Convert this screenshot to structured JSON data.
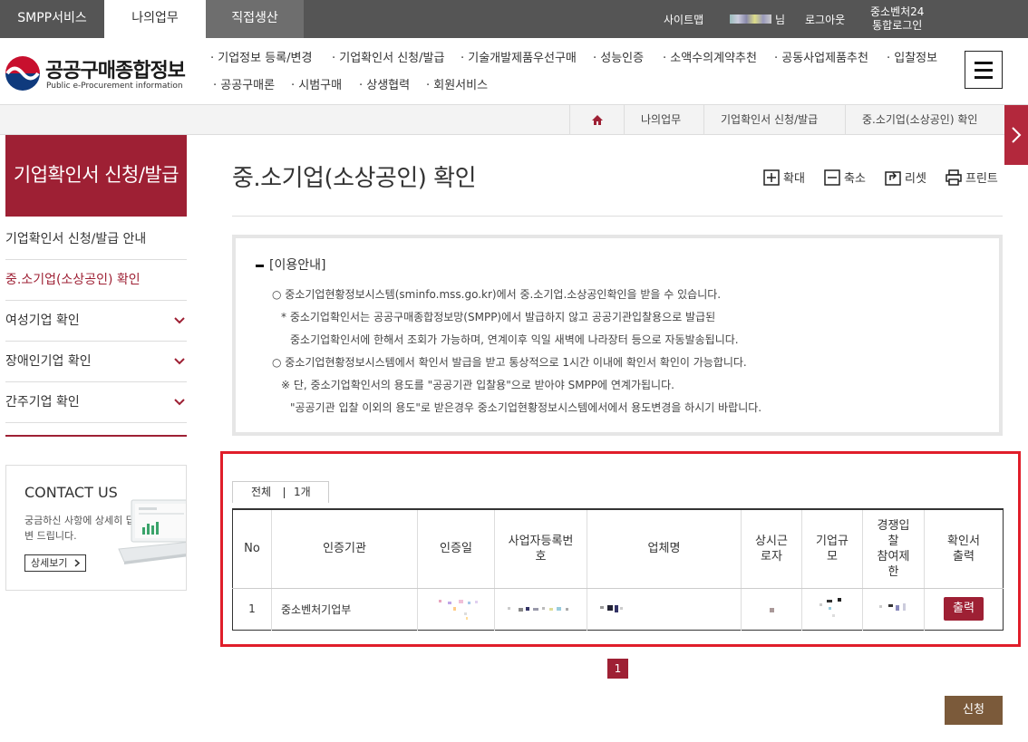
{
  "top_tabs": [
    "SMPP서비스",
    "나의업무",
    "직접생산"
  ],
  "top_util": {
    "sitemap": "사이트맵",
    "user_suffix": "님",
    "logout": "로그아웃",
    "ventures_line1": "중소벤처24",
    "ventures_line2": "통합로그인"
  },
  "logo": {
    "title": "공공구매종합정보",
    "subtitle": "Public e-Procurement information"
  },
  "gnb": [
    "기업정보 등록/변경",
    "기업확인서 신청/발급",
    "기술개발제품우선구매",
    "성능인증",
    "소액수의계약추천",
    "공동사업제품추천",
    "입찰정보",
    "공공구매론",
    "시범구매",
    "상생협력",
    "회원서비스"
  ],
  "breadcrumb": [
    "나의업무",
    "기업확인서 신청/발급",
    "중.소기업(소상공인) 확인"
  ],
  "sidebar": {
    "title": "기업확인서 신청/발급",
    "items": [
      {
        "label": "기업확인서 신청/발급 안내",
        "has_children": false,
        "active": false
      },
      {
        "label": "중.소기업(소상공인) 확인",
        "has_children": false,
        "active": true
      },
      {
        "label": "여성기업 확인",
        "has_children": true,
        "active": false
      },
      {
        "label": "장애인기업 확인",
        "has_children": true,
        "active": false
      },
      {
        "label": "간주기업 확인",
        "has_children": true,
        "active": false
      }
    ],
    "contact": {
      "heading": "CONTACT US",
      "desc": "궁금하신 사항에 상세히 답변 드립니다.",
      "button": "상세보기"
    }
  },
  "page": {
    "title": "중.소기업(소상공인) 확인",
    "tools": {
      "zoom_in": "확대",
      "zoom_out": "축소",
      "reset": "리셋",
      "print": "프린트"
    }
  },
  "notice": {
    "heading": "[이용안내]",
    "lines": [
      "○ 중소기업현황정보시스템(sminfo.mss.go.kr)에서 중.소기업.소상공인확인을 받을 수 있습니다.",
      "* 중소기업확인서는 공공구매종합정보망(SMPP)에서 발급하지 않고 공공기관입찰용으로 발급된",
      "중소기업확인서에 한해서 조회가 가능하며, 연계이후 익일 새벽에 나라장터 등으로 자동발송됩니다.",
      "○ 중소기업현황정보시스템에서 확인서 발급을 받고 통상적으로 1시간 이내에 확인서 확인이 가능합니다.",
      "※ 단, 중소기업확인서의 용도를 \"공공기관 입찰용\"으로 받아야 SMPP에 연계가됩니다.",
      "\"공공기관 입찰 이외의 용도\"로 받은경우 중소기업현황정보시스템에서에서 용도변경을 하시기 바랍니다."
    ]
  },
  "result": {
    "count_label": "전체",
    "count_value": "1개",
    "columns": [
      "No",
      "인증기관",
      "인증일",
      "사업자등록번\n호",
      "업체명",
      "상시근\n로자",
      "기업규\n모",
      "경쟁입\n찰\n참여제\n한",
      "확인서\n출력"
    ],
    "rows": [
      {
        "no": "1",
        "agency": "중소벤처기업부",
        "print_button": "출력"
      }
    ]
  },
  "pager": {
    "current": "1"
  },
  "apply_button": "신청",
  "colors": {
    "brand": "#9e2034",
    "topbar": "#555555",
    "highlight": "#e01e2a",
    "apply": "#7b5a3a"
  }
}
